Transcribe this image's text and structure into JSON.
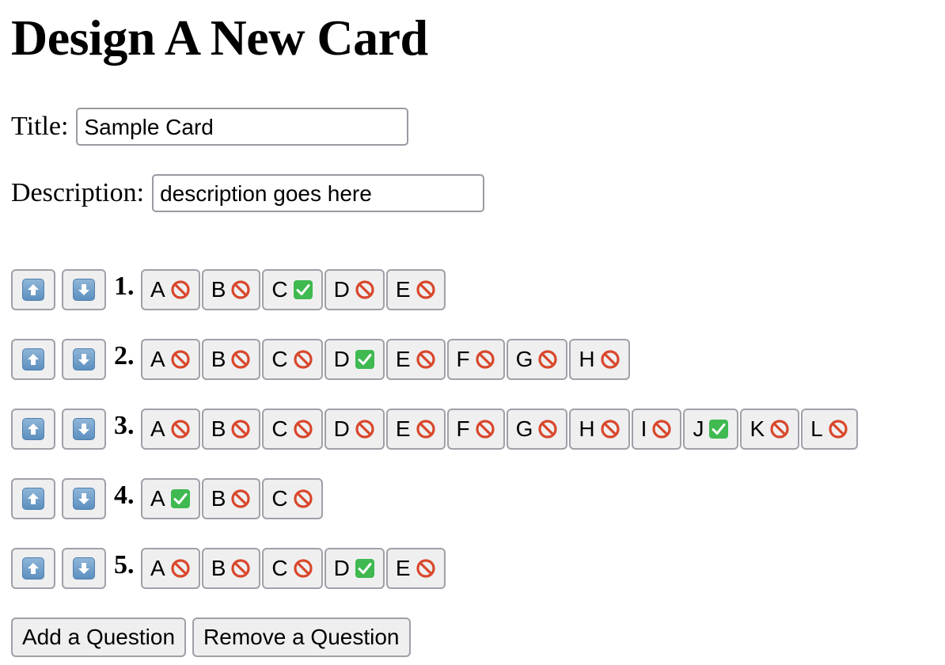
{
  "page": {
    "heading": "Design A New Card"
  },
  "form": {
    "title_label": "Title:",
    "title_value": "Sample Card",
    "description_label": "Description:",
    "description_value": "description goes here"
  },
  "questions": [
    {
      "number": "1.",
      "choices": [
        {
          "letter": "A",
          "correct": false
        },
        {
          "letter": "B",
          "correct": false
        },
        {
          "letter": "C",
          "correct": true
        },
        {
          "letter": "D",
          "correct": false
        },
        {
          "letter": "E",
          "correct": false
        }
      ]
    },
    {
      "number": "2.",
      "choices": [
        {
          "letter": "A",
          "correct": false
        },
        {
          "letter": "B",
          "correct": false
        },
        {
          "letter": "C",
          "correct": false
        },
        {
          "letter": "D",
          "correct": true
        },
        {
          "letter": "E",
          "correct": false
        },
        {
          "letter": "F",
          "correct": false
        },
        {
          "letter": "G",
          "correct": false
        },
        {
          "letter": "H",
          "correct": false
        }
      ]
    },
    {
      "number": "3.",
      "choices": [
        {
          "letter": "A",
          "correct": false
        },
        {
          "letter": "B",
          "correct": false
        },
        {
          "letter": "C",
          "correct": false
        },
        {
          "letter": "D",
          "correct": false
        },
        {
          "letter": "E",
          "correct": false
        },
        {
          "letter": "F",
          "correct": false
        },
        {
          "letter": "G",
          "correct": false
        },
        {
          "letter": "H",
          "correct": false
        },
        {
          "letter": "I",
          "correct": false
        },
        {
          "letter": "J",
          "correct": true
        },
        {
          "letter": "K",
          "correct": false
        },
        {
          "letter": "L",
          "correct": false
        }
      ]
    },
    {
      "number": "4.",
      "choices": [
        {
          "letter": "A",
          "correct": true
        },
        {
          "letter": "B",
          "correct": false
        },
        {
          "letter": "C",
          "correct": false
        }
      ]
    },
    {
      "number": "5.",
      "choices": [
        {
          "letter": "A",
          "correct": false
        },
        {
          "letter": "B",
          "correct": false
        },
        {
          "letter": "C",
          "correct": false
        },
        {
          "letter": "D",
          "correct": true
        },
        {
          "letter": "E",
          "correct": false
        }
      ]
    }
  ],
  "icons": {
    "move_up": "up-arrow-icon",
    "move_down": "down-arrow-icon",
    "incorrect": "prohibited-icon",
    "correct": "check-mark-icon"
  },
  "colors": {
    "incorrect_red": "#d9472b",
    "correct_green": "#3fb950",
    "arrow_blue": "#5c8fbf"
  },
  "actions": {
    "add_label": "Add a Question",
    "remove_label": "Remove a Question"
  }
}
